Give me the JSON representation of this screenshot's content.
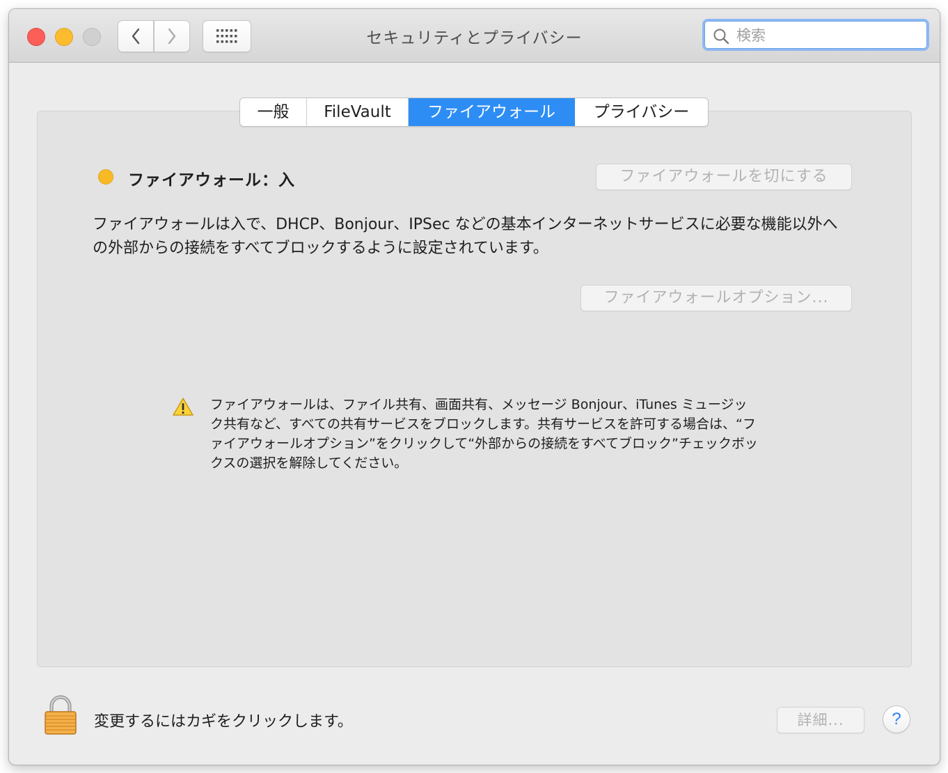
{
  "window": {
    "title": "セキュリティとプライバシー"
  },
  "toolbar": {
    "back_icon": "chevron-left-icon",
    "forward_icon": "chevron-right-icon",
    "show_all_icon": "grid-icon"
  },
  "search": {
    "placeholder": "検索",
    "value": ""
  },
  "tabs": [
    {
      "label": "一般",
      "active": false
    },
    {
      "label": "FileVault",
      "active": false
    },
    {
      "label": "ファイアウォール",
      "active": true
    },
    {
      "label": "プライバシー",
      "active": false
    }
  ],
  "firewall": {
    "status_label": "ファイアウォール：入",
    "status_color": "#f8b926",
    "turn_off_button": "ファイアウォールを切にする",
    "description": "ファイアウォールは入で、DHCP、Bonjour、IPSec などの基本インターネットサービスに必要な機能以外への外部からの接続をすべてブロックするように設定されています。",
    "options_button": "ファイアウォールオプション...",
    "warning_text": "ファイアウォールは、ファイル共有、画面共有、メッセージ Bonjour、iTunes ミュージック共有など、すべての共有サービスをブロックします。共有サービスを許可する場合は、“ファイアウォールオプション”をクリックして“外部からの接続をすべてブロック”チェックボックスの選択を解除してください。"
  },
  "footer": {
    "lock_text": "変更するにはカギをクリックします。",
    "details_button": "詳細...",
    "help_button": "?"
  },
  "colors": {
    "accent": "#2d8df5",
    "close": "#fc5f57",
    "minimize": "#fdbc2e",
    "zoom_disabled": "#d0d0d0"
  }
}
